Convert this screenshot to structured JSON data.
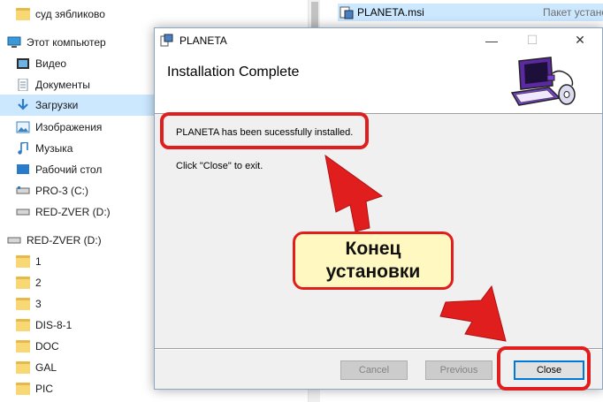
{
  "explorer": {
    "nav_items": [
      {
        "label": "суд зябликово",
        "icon": "folder-icon"
      },
      {
        "label": "Этот компьютер",
        "icon": "computer-icon"
      },
      {
        "label": "Видео",
        "icon": "video-icon"
      },
      {
        "label": "Документы",
        "icon": "documents-icon"
      },
      {
        "label": "Загрузки",
        "icon": "download-icon",
        "selected": true
      },
      {
        "label": "Изображения",
        "icon": "pictures-icon"
      },
      {
        "label": "Музыка",
        "icon": "music-icon"
      },
      {
        "label": "Рабочий стол",
        "icon": "desktop-icon"
      },
      {
        "label": "PRO-3 (C:)",
        "icon": "drive-icon"
      },
      {
        "label": "RED-ZVER (D:)",
        "icon": "drive-icon"
      },
      {
        "label": "RED-ZVER (D:)",
        "icon": "drive-icon"
      },
      {
        "label": "1",
        "icon": "folder-icon"
      },
      {
        "label": "2",
        "icon": "folder-icon"
      },
      {
        "label": "3",
        "icon": "folder-icon"
      },
      {
        "label": "DIS-8-1",
        "icon": "folder-icon"
      },
      {
        "label": "DOC",
        "icon": "folder-icon"
      },
      {
        "label": "GAL",
        "icon": "folder-icon"
      },
      {
        "label": "PIC",
        "icon": "folder-icon"
      }
    ],
    "file": {
      "name": "PLANETA.msi",
      "type": "Пакет устано"
    }
  },
  "dialog": {
    "title": "PLANETA",
    "heading": "Installation Complete",
    "message": "PLANETA has been sucessfully installed.",
    "instruction": "Click \"Close\" to exit.",
    "buttons": {
      "cancel": "Cancel",
      "previous": "Previous",
      "close": "Close"
    },
    "titlebar": {
      "min": "—",
      "max": "☐",
      "close": "✕"
    }
  },
  "annotation": {
    "line1": "Конец",
    "line2": "установки",
    "color": "#e01e1e",
    "fill": "#fff8c0"
  }
}
